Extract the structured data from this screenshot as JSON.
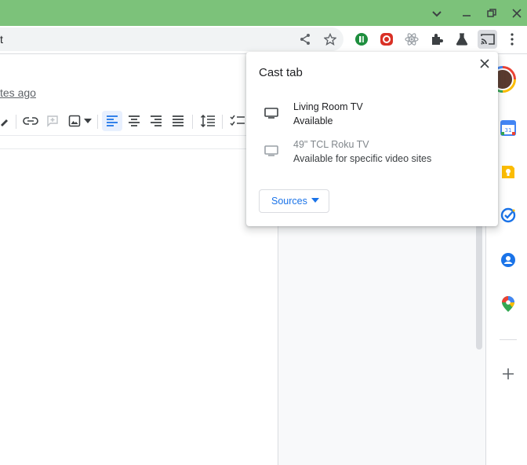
{
  "browser": {
    "omnibox_text": "t",
    "colors": {
      "titlebar": "#7cc27a",
      "accent": "#1a73e8"
    }
  },
  "doc": {
    "last_edit": "tes ago"
  },
  "cast_popup": {
    "title": "Cast tab",
    "close_icon": "close-icon",
    "sinks": [
      {
        "name": "Living Room TV",
        "status": "Available",
        "enabled": true,
        "icon": "tv-icon"
      },
      {
        "name": "49\" TCL Roku TV",
        "status": "Available for specific video sites",
        "enabled": false,
        "icon": "tv-icon"
      }
    ],
    "sources_label": "Sources"
  }
}
